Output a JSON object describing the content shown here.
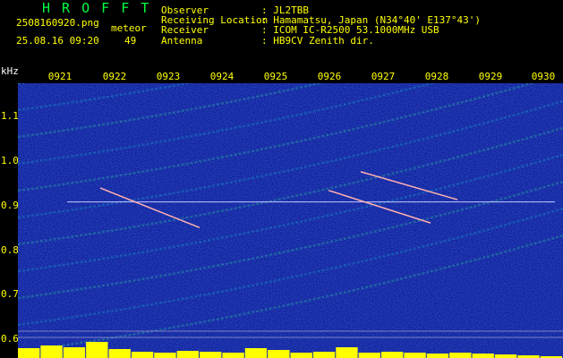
{
  "header": {
    "brand": "H R O F F T",
    "filename": "2508160920.png",
    "mode_label": "meteor",
    "datetime": "25.08.16 09:20",
    "count": "49",
    "info_labels": [
      "Observer",
      "Receiving Location",
      "Receiver",
      "Antenna"
    ],
    "info_values": [
      ": JL2TBB",
      ": Hamamatsu, Japan (N34°40' E137°43')",
      ": ICOM IC-R2500 53.1000MHz USB",
      ": HB9CV Zenith dir."
    ]
  },
  "colors": {
    "text_yellow": "#ffff00",
    "brand_green": "#00ff40",
    "background_blue": "#0a1a90",
    "carrier_line": "#c8c8ff",
    "activity_bars": "#ffff00"
  },
  "chart_data": {
    "type": "heatmap",
    "title": "",
    "ylabel": "kHz",
    "x_ticks": [
      "0921",
      "0922",
      "0923",
      "0924",
      "0925",
      "0926",
      "0927",
      "0928",
      "0929",
      "0930"
    ],
    "y_ticks": [
      "1.1",
      "1.0",
      "0.9",
      "0.8",
      "0.7",
      "0.6"
    ],
    "ylim": [
      0.59,
      1.18
    ],
    "carrier_khz": 0.925,
    "meteor_echoes": [
      {
        "x_start_min": 0.75,
        "x_end_min": 2.6,
        "y_start_khz": 0.955,
        "y_end_khz": 0.87
      },
      {
        "x_start_min": 5.0,
        "x_end_min": 6.9,
        "y_start_khz": 0.95,
        "y_end_khz": 0.88
      },
      {
        "x_start_min": 5.6,
        "x_end_min": 7.4,
        "y_start_khz": 0.99,
        "y_end_khz": 0.93
      }
    ],
    "activity_bar_levels": [
      0.55,
      0.7,
      0.6,
      0.9,
      0.5,
      0.35,
      0.3,
      0.4,
      0.35,
      0.3,
      0.55,
      0.45,
      0.3,
      0.35,
      0.6,
      0.3,
      0.35,
      0.3,
      0.25,
      0.3,
      0.25,
      0.2,
      0.15,
      0.1
    ],
    "grid": false
  }
}
